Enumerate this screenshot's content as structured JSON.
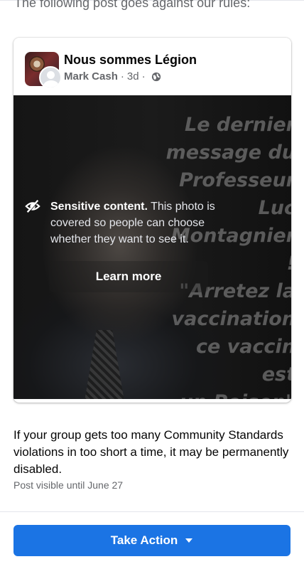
{
  "notice": {
    "text": "The following post goes against our rules:"
  },
  "post": {
    "group_name": "Nous sommes Légion",
    "author": "Mark Cash",
    "separator": "·",
    "time": "3d",
    "audience_icon": "globe-icon",
    "image_text": "Le dernier\nmessage du\nProfesseur\nLuc\nMontagnier\n!\n\"Arretez la\nvaccination\nce vaccin est\nun Poison\"",
    "sensitive": {
      "icon": "eye-slash-icon",
      "title": "Sensitive content.",
      "body": "This photo is covered so people can choose whether they want to see it.",
      "learn_more_label": "Learn more"
    }
  },
  "warning": {
    "text": "If your group gets too many Community Standards violations in too short a time, it may be permanently disabled.",
    "visible_until": "Post visible until June 27"
  },
  "action": {
    "label": "Take Action",
    "icon": "caret-down-icon",
    "color": "#1b74e4"
  }
}
